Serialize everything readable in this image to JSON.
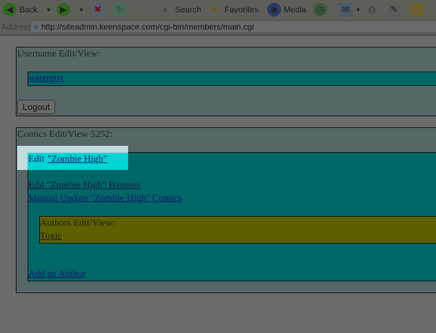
{
  "toolbar": {
    "back": "Back",
    "search": "Search",
    "favorites": "Favorites",
    "media": "Media"
  },
  "address": {
    "label": "Address",
    "url": "http://siteadmin.keenspace.com/cgi-bin/members/main.cgi"
  },
  "username_section": {
    "title": "Username Edit/View:",
    "username": "waterguy",
    "logout": "Logout"
  },
  "comics_section": {
    "title": "Comics Edit/View 5252:",
    "edit_prefix": "Edit ",
    "edit_link": "\"Zombie High\"",
    "banners_link": "Edit \"Zombie High\" Banners",
    "manual_update_link": "Manual Update \"Zombie High\" Comics",
    "authors_title": "Authors Edit/View:",
    "authors": [
      "Toxic"
    ],
    "add_author": "Add an Author"
  }
}
